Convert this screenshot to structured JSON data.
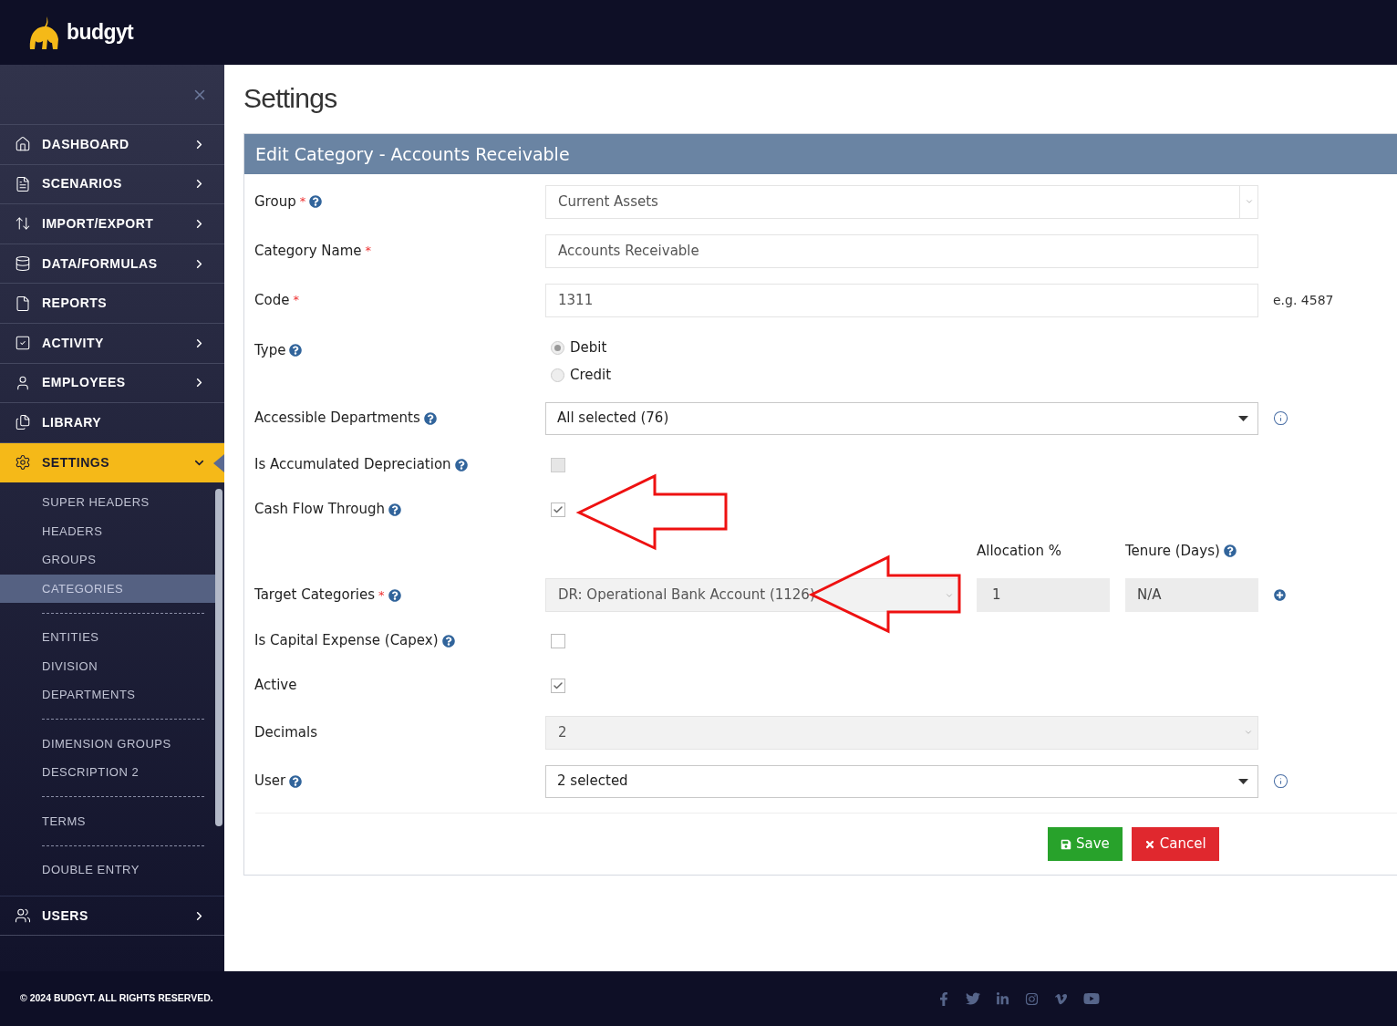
{
  "brand": {
    "name": "budgyt"
  },
  "sidebar": {
    "items": [
      {
        "label": "DASHBOARD",
        "has_arrow": true,
        "expanded": false
      },
      {
        "label": "SCENARIOS",
        "has_arrow": true,
        "expanded": false
      },
      {
        "label": "IMPORT/EXPORT",
        "has_arrow": true,
        "expanded": false
      },
      {
        "label": "DATA/FORMULAS",
        "has_arrow": true,
        "expanded": false
      },
      {
        "label": "REPORTS",
        "has_arrow": false,
        "expanded": false
      },
      {
        "label": "ACTIVITY",
        "has_arrow": true,
        "expanded": false
      },
      {
        "label": "EMPLOYEES",
        "has_arrow": true,
        "expanded": false
      },
      {
        "label": "LIBRARY",
        "has_arrow": false,
        "expanded": false
      },
      {
        "label": "SETTINGS",
        "has_arrow": true,
        "expanded": true,
        "children": [
          {
            "kind": "link",
            "label": "SUPER HEADERS",
            "selected": false
          },
          {
            "kind": "link",
            "label": "HEADERS",
            "selected": false
          },
          {
            "kind": "link",
            "label": "GROUPS",
            "selected": false
          },
          {
            "kind": "link",
            "label": "CATEGORIES",
            "selected": true
          },
          {
            "kind": "divider"
          },
          {
            "kind": "link",
            "label": "ENTITIES",
            "selected": false
          },
          {
            "kind": "link",
            "label": "DIVISION",
            "selected": false
          },
          {
            "kind": "link",
            "label": "DEPARTMENTS",
            "selected": false
          },
          {
            "kind": "divider"
          },
          {
            "kind": "link",
            "label": "DIMENSION GROUPS",
            "selected": false
          },
          {
            "kind": "link",
            "label": "DESCRIPTION 2",
            "selected": false
          },
          {
            "kind": "divider"
          },
          {
            "kind": "link",
            "label": "TERMS",
            "selected": false
          },
          {
            "kind": "divider"
          },
          {
            "kind": "link",
            "label": "DOUBLE ENTRY",
            "selected": false
          }
        ]
      },
      {
        "label": "USERS",
        "has_arrow": true,
        "expanded": false
      }
    ]
  },
  "page": {
    "title": "Settings"
  },
  "form": {
    "title": "Edit Category - Accounts Receivable",
    "fields": [
      {
        "kind": "select",
        "label": "Group",
        "required_mark": "*",
        "help": true,
        "value": "Current Assets",
        "disabled": false
      },
      {
        "kind": "text",
        "label": "Category Name",
        "required_mark": "*",
        "help": false,
        "value": "Accounts Receivable"
      },
      {
        "kind": "text",
        "label": "Code",
        "required_mark": "*",
        "help": false,
        "value": "1311",
        "hint": "e.g. 4587"
      },
      {
        "kind": "radio",
        "label": "Type",
        "help": true,
        "options": [
          {
            "label": "Debit",
            "selected": true
          },
          {
            "label": "Credit",
            "selected": false
          }
        ]
      },
      {
        "kind": "multiselect",
        "label": "Accessible Departments",
        "help": true,
        "value": "All selected (76)"
      },
      {
        "kind": "checkbox",
        "label": "Is Accumulated Depreciation",
        "help": true,
        "checked": false,
        "disabled": true
      },
      {
        "kind": "checkbox",
        "label": "Cash Flow Through",
        "help": true,
        "checked": true,
        "disabled": false
      },
      {
        "kind": "target",
        "label": "Target Categories",
        "required_mark": "*",
        "help": true,
        "value": "DR: Operational Bank Account (1126)",
        "allocation_label": "Allocation %",
        "allocation": "1",
        "tenure_label": "Tenure (Days)",
        "tenure": "N/A"
      },
      {
        "kind": "checkbox",
        "label": "Is Capital Expense (Capex)",
        "help": true,
        "checked": false,
        "disabled": false
      },
      {
        "kind": "checkbox",
        "label": "Active",
        "help": false,
        "checked": true,
        "disabled": false
      },
      {
        "kind": "select",
        "label": "Decimals",
        "help": false,
        "value": "2",
        "disabled": true
      },
      {
        "kind": "multiselect",
        "label": "User",
        "help": true,
        "value": "2 selected"
      }
    ],
    "buttons": [
      {
        "kind": "save",
        "label": "Save"
      },
      {
        "kind": "cancel",
        "label": "Cancel"
      }
    ]
  },
  "footer": {
    "copyright": "© 2024 BUDGYT. ALL RIGHTS RESERVED."
  }
}
